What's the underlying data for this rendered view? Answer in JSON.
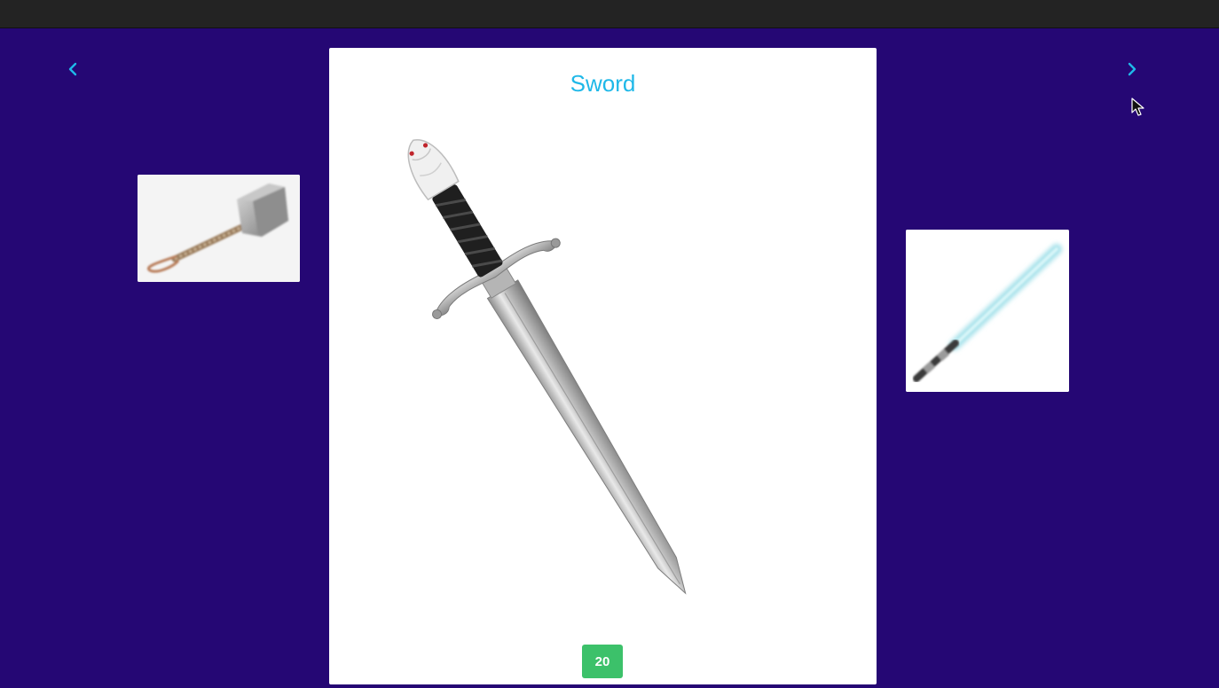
{
  "carousel": {
    "current_item": {
      "title": "Sword",
      "badge_value": "20",
      "image_icon": "sword-icon"
    },
    "prev_item": {
      "image_icon": "hammer-icon"
    },
    "next_item": {
      "image_icon": "lightsaber-icon"
    },
    "prev_arrow_icon": "chevron-left-icon",
    "next_arrow_icon": "chevron-right-icon"
  },
  "colors": {
    "background": "#250774",
    "title": "#1fb8e8",
    "badge": "#3cc16a",
    "top_bar": "#232323",
    "card": "#ffffff"
  }
}
